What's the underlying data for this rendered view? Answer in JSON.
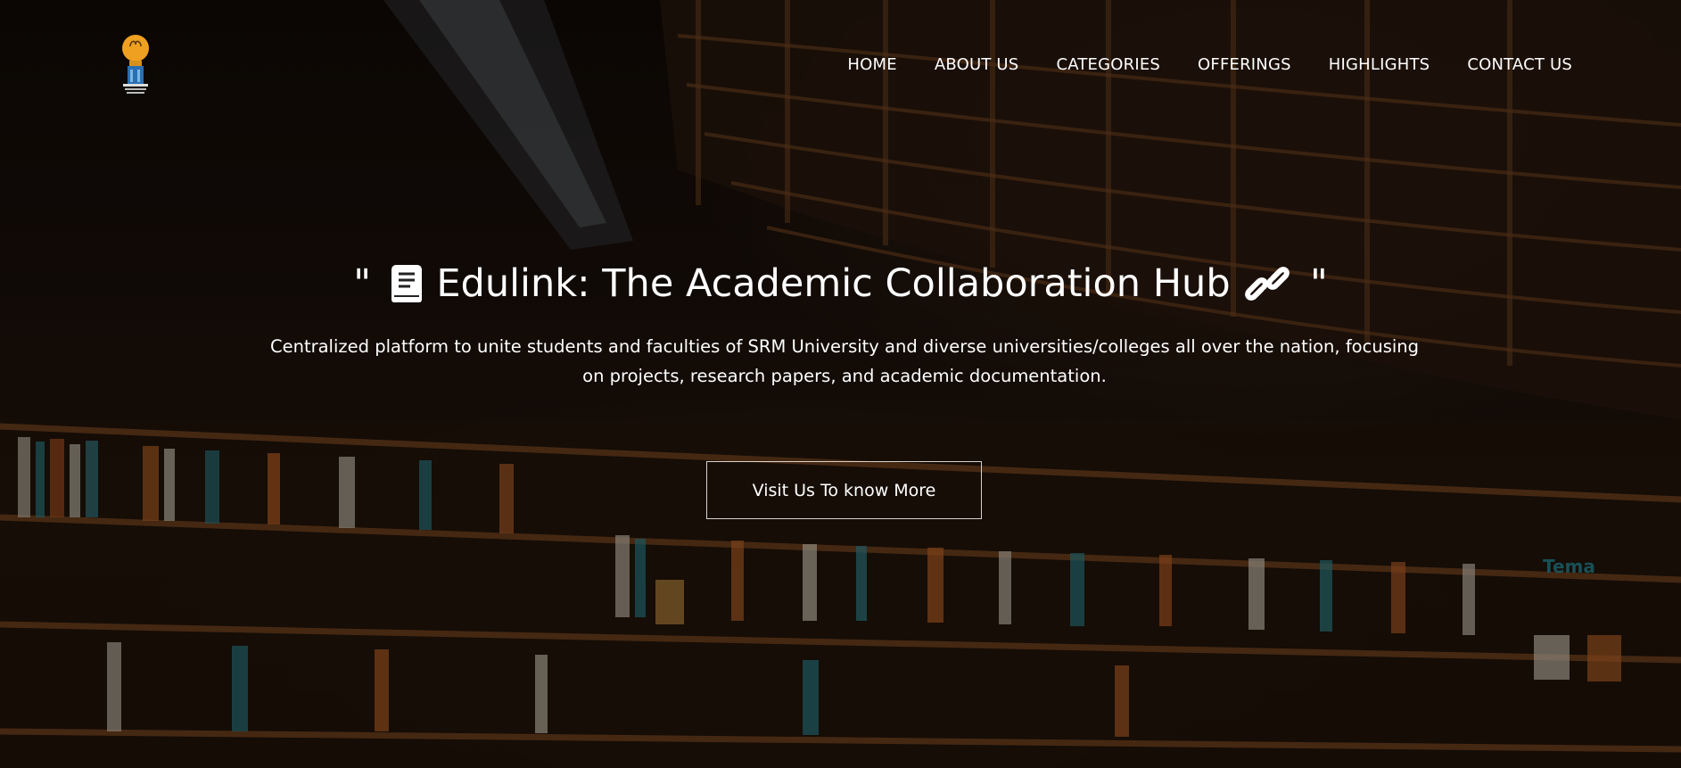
{
  "brand": {
    "logo_icon": "lightbulb-logo-icon",
    "accent_color": "#f0a020"
  },
  "nav": {
    "items": [
      {
        "label": "HOME"
      },
      {
        "label": "ABOUT US"
      },
      {
        "label": "CATEGORIES"
      },
      {
        "label": "OFFERINGS"
      },
      {
        "label": "HIGHLIGHTS"
      },
      {
        "label": "CONTACT US"
      }
    ]
  },
  "hero": {
    "quote_open": "\"",
    "title": "Edulink: The Academic Collaboration Hub",
    "quote_close": "\"",
    "title_icon_left": "book-icon",
    "title_icon_right": "link-icon",
    "subtitle": "Centralized platform to unite students and faculties of SRM University and diverse universities/colleges all over the nation, focusing on projects, research papers, and academic documentation.",
    "cta_label": "Visit Us To know More"
  },
  "background": {
    "scene": "library bookshelves",
    "sign_text": "Tema",
    "sign_color": "#2aa6b8"
  }
}
